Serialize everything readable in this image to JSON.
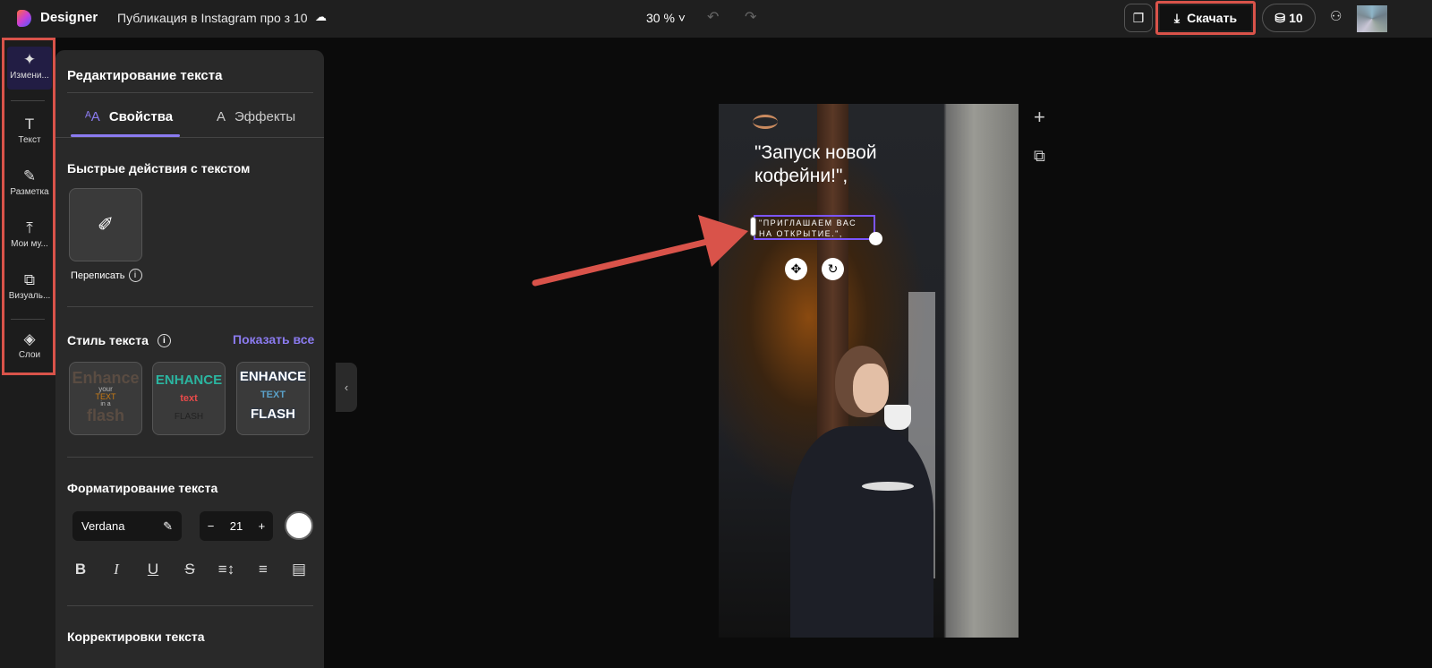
{
  "app": {
    "name": "Designer",
    "doc_title": "Публикация в Instagram про з 10",
    "zoom": "30 %"
  },
  "toolbar": {
    "download_label": "Скачать",
    "credits": "10"
  },
  "rail": {
    "items": [
      {
        "label": "Измени...",
        "icon": "sparkle-icon"
      },
      {
        "label": "Текст",
        "icon": "text-icon"
      },
      {
        "label": "Разметка",
        "icon": "pen-icon"
      },
      {
        "label": "Мои му...",
        "icon": "upload-icon"
      },
      {
        "label": "Визуаль...",
        "icon": "visuals-icon"
      },
      {
        "label": "Слои",
        "icon": "layers-icon"
      }
    ]
  },
  "panel": {
    "title": "Редактирование текста",
    "tabs": [
      {
        "label": "Свойства",
        "active": true
      },
      {
        "label": "Эффекты",
        "active": false
      }
    ],
    "quick_actions": {
      "title": "Быстрые действия с текстом",
      "rewrite": "Переписать"
    },
    "text_style": {
      "title": "Стиль текста",
      "show_all": "Показать все",
      "cards": [
        {
          "lines": [
            "Enhance",
            "your",
            "TEXT",
            "in a",
            "flash"
          ]
        },
        {
          "lines": [
            "ENHANCE",
            "text",
            "FLASH"
          ]
        },
        {
          "lines": [
            "ENHANCE",
            "TEXT",
            "FLASH"
          ]
        }
      ]
    },
    "formatting": {
      "title": "Форматирование текста",
      "font": "Verdana",
      "size": "21",
      "color": "#ffffff"
    },
    "adjust": {
      "title": "Корректировки текста"
    }
  },
  "canvas": {
    "headline": "\"Запуск новой кофейни!\",",
    "subtext": "\"ПРИГЛАШАЕМ ВАС НА ОТКРЫТИЕ.\","
  },
  "colors": {
    "accent": "#8b7bf0",
    "highlight": "#d9534a",
    "selection": "#7b55ff"
  }
}
